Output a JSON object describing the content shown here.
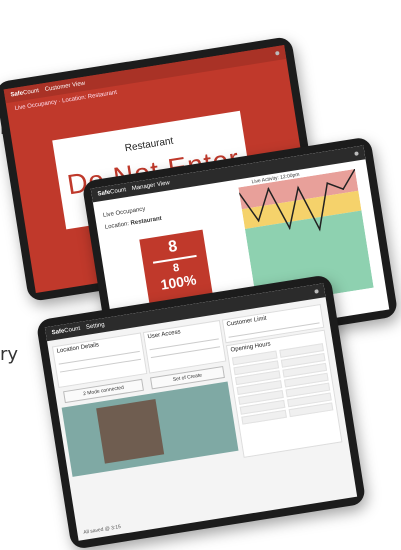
{
  "side_text": {
    "quote_fragment": "r”",
    "word_fragment": "ry"
  },
  "app": {
    "brand_safe": "Safe",
    "brand_count": "Count"
  },
  "tablet1": {
    "view_title": "Customer View",
    "subtitle": "Live Occupancy · Location: Restaurant",
    "location": "Restaurant",
    "message": "Do Not Enter"
  },
  "tablet2": {
    "view_title": "Manager View",
    "live_occupancy": "Live Occupancy",
    "location_label": "Location:",
    "location_value": "Restaurant",
    "count": "8",
    "capacity": "8",
    "percent": "100%",
    "chart_title": "Live Activity: 12:00pm",
    "chart_colors": {
      "red_band": "#e8a09a",
      "yellow_band": "#f5d26b",
      "green_band": "#8ed1b0"
    },
    "chart_data": {
      "type": "line",
      "y": [
        95,
        70,
        95,
        60,
        92,
        55,
        92,
        85,
        100
      ]
    }
  },
  "tablet3": {
    "view_title": "Setting",
    "location_details": "Location Details",
    "user_access": "User Access",
    "customer_limit": "Customer Limit",
    "opening_hours": "Opening Hours",
    "button_connected": "2 Mode connected",
    "button_create": "Set of Create",
    "footer": "All saved @ 3:15"
  }
}
